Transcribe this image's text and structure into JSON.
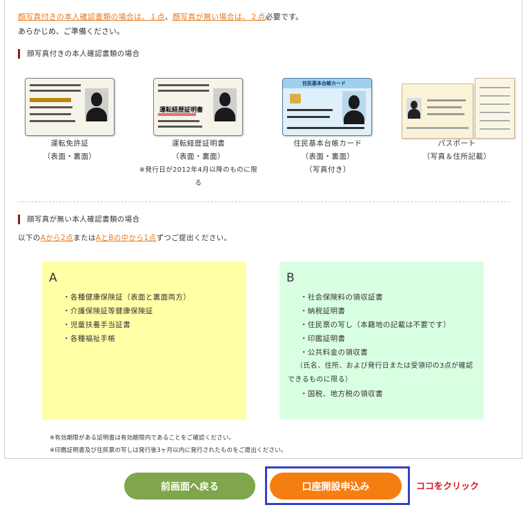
{
  "intro": {
    "link1": "顔写真付きの本人確認書類の場合は、１点",
    "sep1": "、",
    "link2": "顔写真が無い場合は、２点",
    "tail": "必要です。",
    "line2": "あらかじめ、ご準備ください。"
  },
  "with_photo": {
    "title": "顔写真付きの本人確認書類の場合",
    "cards": [
      {
        "label": "運転免許証",
        "sub": "（表面・裏面）"
      },
      {
        "label": "運転経歴証明書",
        "sub": "（表面・裏面）",
        "note1": "※発行日が2012年4月以降のものに限",
        "note2": "る",
        "card_text": "運転経歴証明書"
      },
      {
        "label": "住民基本台帳カード",
        "sub": "（表面・裏面）",
        "sub2": "（写真付き）",
        "card_text": "住民基本台帳カード"
      },
      {
        "label": "パスポート",
        "sub": "（写真＆住所記載）"
      }
    ]
  },
  "without_photo": {
    "title": "顔写真が無い本人確認書類の場合",
    "instr_pre": "以下の",
    "instr_link1": "Aから2点",
    "instr_mid": "または",
    "instr_link2": "AとBの中から1点",
    "instr_post": "ずつご提出ください。",
    "box_a": {
      "letter": "A",
      "items": [
        "・各種健康保険証（表面と裏面両方）",
        "・介護保険証等健康保険証",
        "・児童扶養手当証書",
        "・各種福祉手帳"
      ]
    },
    "box_b": {
      "letter": "B",
      "items": [
        "・社会保険料の領収証書",
        "・納税証明書",
        "・住民票の写し（本籍地の記載は不要です）",
        "・印鑑証明書",
        "・公共料金の領収書"
      ],
      "paren1": "（氏名、住所、および発行日または受領印の3点が確認",
      "paren2": "できるものに限る）",
      "last": "・国税、地方税の領収書"
    }
  },
  "footnotes": [
    "※有効期限がある証明書は有効期限内であることをご確認ください。",
    "※印鑑証明書及び住民票の写しは発行後3ヶ月以内に発行されたものをご提出ください。"
  ],
  "buttons": {
    "back": "前画面へ戻る",
    "apply": "口座開設申込み"
  },
  "click_here": "ココをクリック",
  "colors": {
    "accent_orange": "#f57e10",
    "back_green": "#7fa64a",
    "highlight_blue": "#3340c8",
    "alert_red": "#e0141e"
  }
}
